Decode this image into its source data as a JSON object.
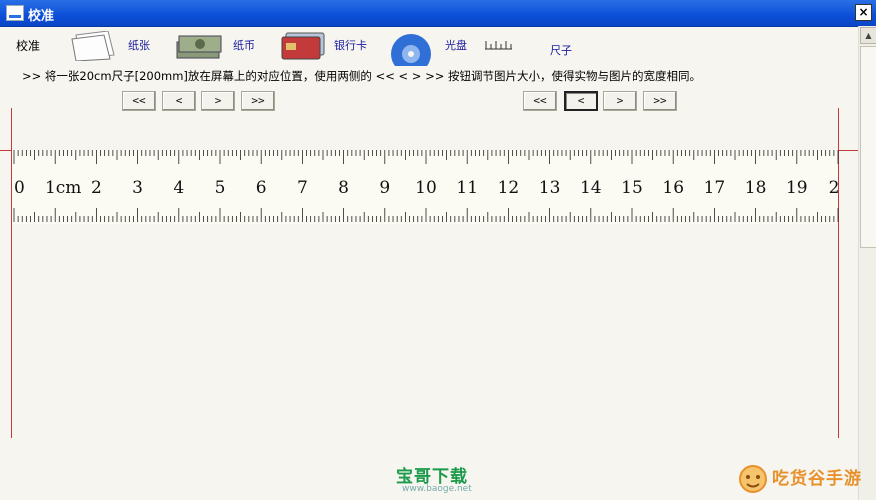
{
  "window": {
    "title": "校准",
    "close_glyph": "×"
  },
  "toolbar": {
    "label": "校准",
    "items": [
      {
        "label": "纸张",
        "icon": "paper-icon"
      },
      {
        "label": "纸币",
        "icon": "banknote-icon"
      },
      {
        "label": "银行卡",
        "icon": "bank-card-icon"
      },
      {
        "label": "光盘",
        "icon": "disc-icon"
      },
      {
        "label": "尺子",
        "icon": "ruler-icon"
      }
    ]
  },
  "instruction": ">>  将一张20cm尺子[200mm]放在屏幕上的对应位置，使用两侧的 <<  <  >  >> 按钮调节图片大小，使得实物与图片的宽度相同。",
  "left_controls": [
    "<<",
    "<",
    ">",
    ">>"
  ],
  "right_controls": [
    "<<",
    "<",
    ">",
    ">>"
  ],
  "ruler": {
    "labels": [
      "0",
      "1cm",
      "2",
      "3",
      "4",
      "5",
      "6",
      "7",
      "8",
      "9",
      "10",
      "11",
      "12",
      "13",
      "14",
      "15",
      "16",
      "17",
      "18",
      "19",
      "2"
    ]
  },
  "watermarks": {
    "left": "宝哥下载",
    "left_url": "www.baoge.net",
    "right": "吃货谷手游"
  },
  "colors": {
    "titlebar": "#0c4fd8",
    "guide_line": "#c23a3a",
    "link": "#1a1a9e"
  }
}
